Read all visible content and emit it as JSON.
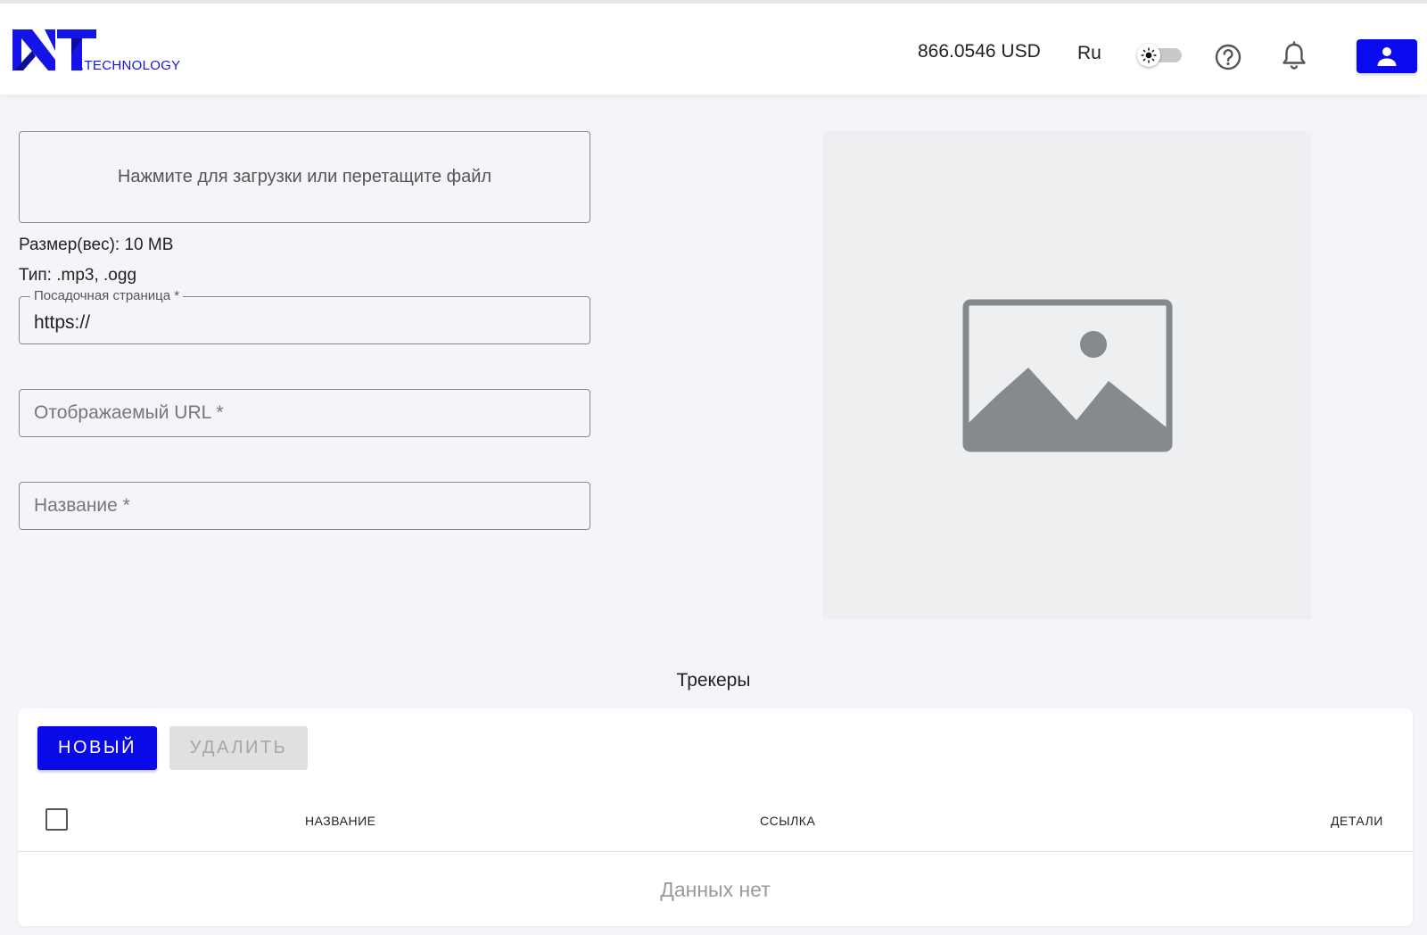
{
  "header": {
    "logo_text": ".TECHNOLOGY",
    "balance": "866.0546 USD",
    "language": "Ru",
    "theme_toggle": "light",
    "brand_color": "#0a0aef"
  },
  "form": {
    "upload_prompt": "Нажмите для загрузки или перетащите файл",
    "size_info": "Размер(вес): 10 MB",
    "type_info": "Тип: .mp3, .ogg",
    "landing_label": "Посадочная страница *",
    "landing_value": "https://",
    "display_url_placeholder": "Отображаемый URL *",
    "name_placeholder": "Название *"
  },
  "preview": {
    "icon": "image-placeholder-icon"
  },
  "trackers": {
    "title": "Трекеры",
    "new_label": "НОВЫЙ",
    "delete_label": "УДАЛИТЬ",
    "columns": [
      "НАЗВАНИЕ",
      "ССЫЛКА",
      "ДЕТАЛИ"
    ],
    "empty_text": "Данных нет"
  }
}
